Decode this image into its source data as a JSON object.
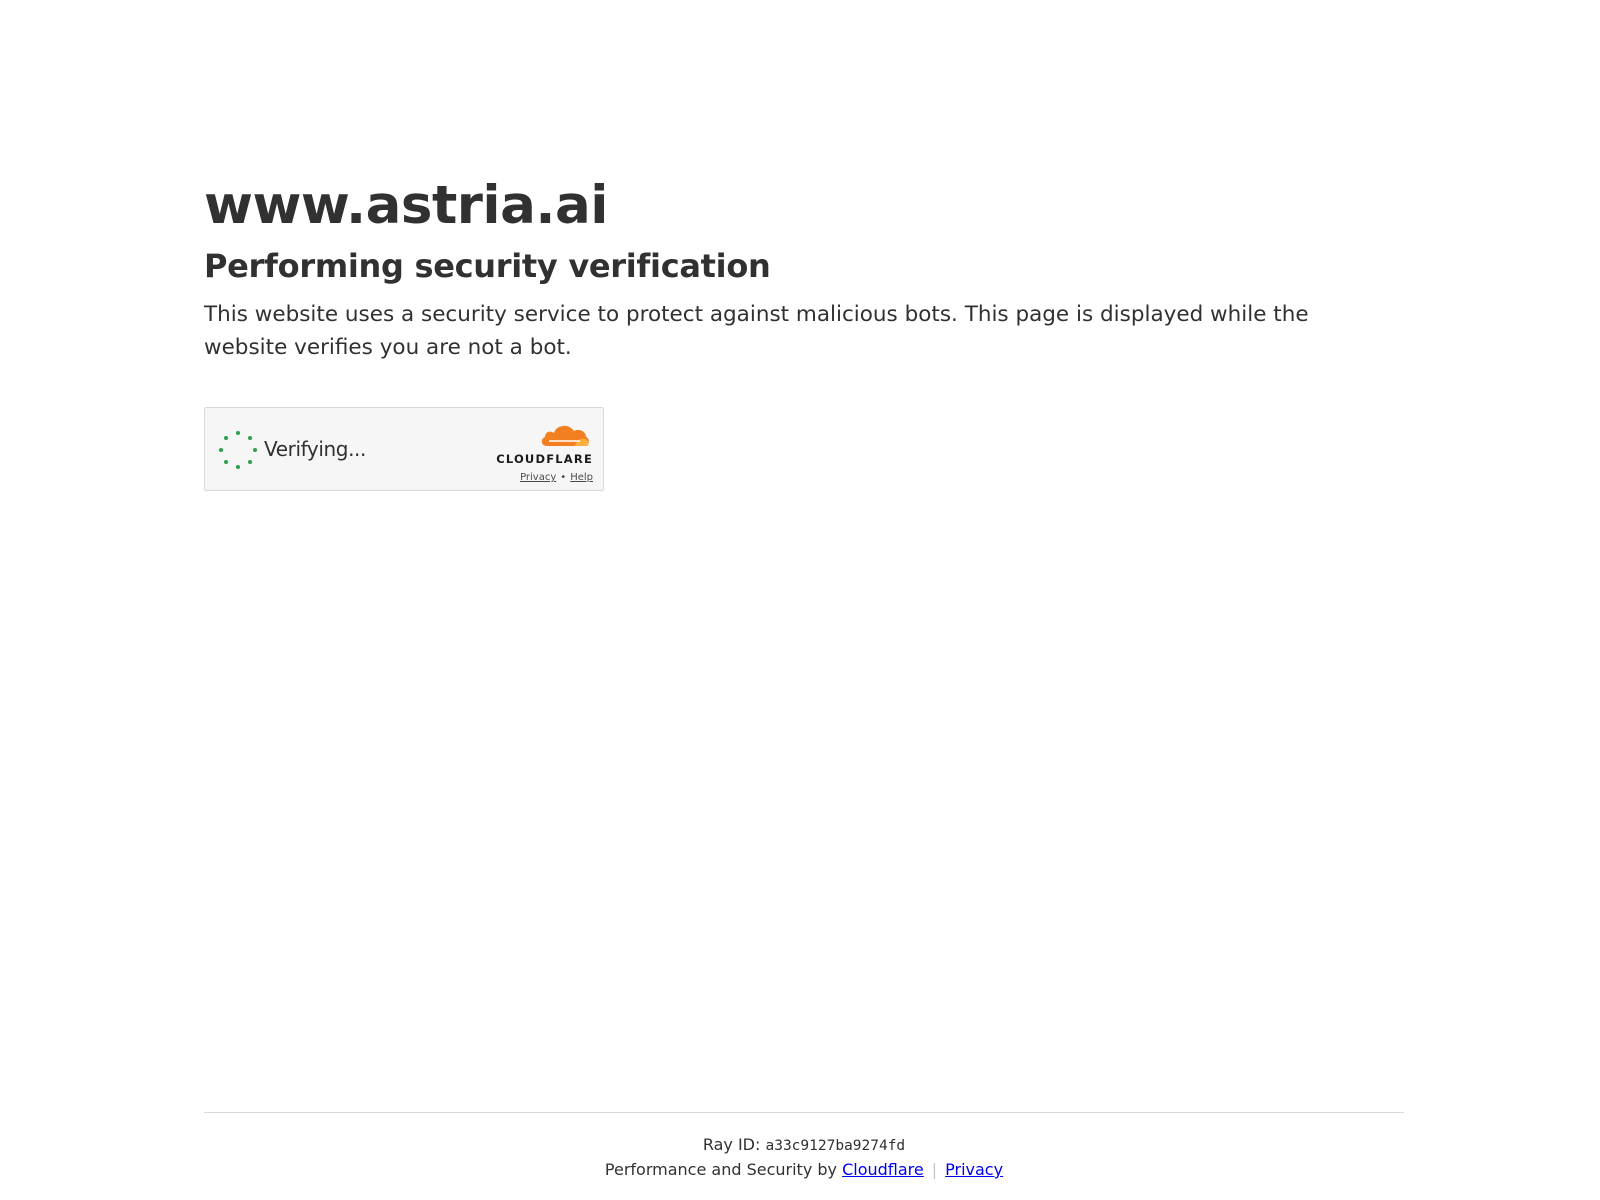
{
  "page": {
    "site_title": "www.astria.ai",
    "heading": "Performing security verification",
    "description": "This website uses a security service to protect against malicious bots. This page is displayed while the website verifies you are not a bot."
  },
  "widget": {
    "status_text": "Verifying...",
    "spinner_icon": "loading-spinner-icon",
    "spinner_color": "#2e9e4f",
    "brand_wordmark": "CLOUDFLARE",
    "brand_logo_icon": "cloudflare-cloud-icon",
    "brand_color": "#f38020",
    "privacy_link": "Privacy",
    "link_separator": "•",
    "help_link": "Help"
  },
  "footer": {
    "ray_label": "Ray ID:",
    "ray_id": "a33c9127ba9274fd",
    "perf_text": "Performance and Security by",
    "cloudflare_link": "Cloudflare",
    "separator": "|",
    "privacy_link": "Privacy",
    "link_color": "#0000ee"
  }
}
